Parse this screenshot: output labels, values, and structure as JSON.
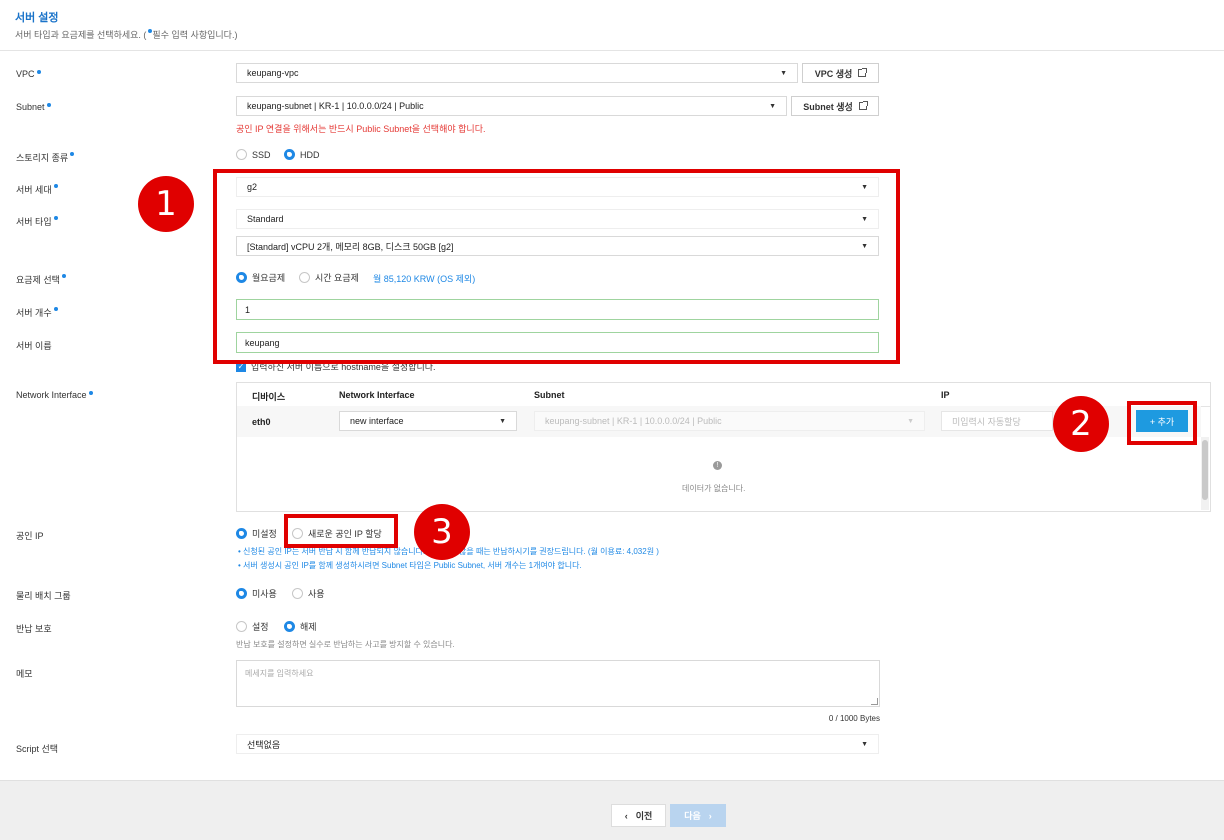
{
  "header": {
    "title": "서버 설정",
    "subtitle_prefix": "서버 타입과 요금제를 선택하세요. (",
    "subtitle_suffix": "필수 입력 사항입니다.)"
  },
  "vpc": {
    "label": "VPC",
    "value": "keupang-vpc",
    "create_label": "VPC 생성"
  },
  "subnet": {
    "label": "Subnet",
    "value": "keupang-subnet | KR-1 | 10.0.0.0/24 | Public",
    "create_label": "Subnet 생성",
    "warning": "공인 IP 연결을 위해서는 반드시 Public Subnet을 선택해야 합니다."
  },
  "storage": {
    "label": "스토리지 종류",
    "options": [
      "SSD",
      "HDD"
    ],
    "selected": "HDD"
  },
  "generation": {
    "label": "서버 세대",
    "value": "g2"
  },
  "server_type": {
    "label": "서버 타입",
    "value": "Standard",
    "spec": "[Standard] vCPU 2개, 메모리 8GB, 디스크 50GB [g2]"
  },
  "pricing": {
    "label": "요금제 선택",
    "options": [
      "월요금제",
      "시간 요금제"
    ],
    "selected": "월요금제",
    "price": "월 85,120 KRW (OS 제외)"
  },
  "server_count": {
    "label": "서버 개수",
    "value": "1"
  },
  "server_name": {
    "label": "서버 이름",
    "value": "keupang",
    "hostname_note": "입력하신 서버 이름으로 hostname을 설정합니다."
  },
  "network_interface": {
    "label": "Network Interface",
    "columns": [
      "디바이스",
      "Network Interface",
      "Subnet",
      "IP"
    ],
    "row": {
      "device": "eth0",
      "interface": "new interface",
      "subnet": "keupang-subnet | KR-1 | 10.0.0.0/24 | Public",
      "ip_placeholder": "미입력시 자동할당"
    },
    "add_label": "+ 추가",
    "empty_text": "데이터가 없습니다."
  },
  "public_ip": {
    "label": "공인 IP",
    "options": [
      "미설정",
      "새로운 공인 IP 할당"
    ],
    "selected": "미설정",
    "note1": "신청된 공인 IP는 서버 반납 시 함께 반납되지 않습니다. 사용하지 않을 때는 반납하시기를 권장드립니다. (월 이용료: 4,032원 )",
    "note2": "서버 생성시 공인 IP를 함께 생성하시려면 Subnet 타입은 Public Subnet, 서버 개수는 1개여야 합니다."
  },
  "placement_group": {
    "label": "물리 배치 그룹",
    "options": [
      "미사용",
      "사용"
    ],
    "selected": "미사용"
  },
  "return_protection": {
    "label": "반납 보호",
    "options": [
      "설정",
      "해제"
    ],
    "selected": "해제",
    "note": "반납 보호를 설정하면 실수로 반납하는 사고를 방지할 수 있습니다."
  },
  "memo": {
    "label": "메모",
    "placeholder": "메세지를 입력하세요",
    "counter": "0 / 1000 Bytes"
  },
  "script": {
    "label": "Script 선택",
    "value": "선택없음"
  },
  "footer": {
    "prev_label": "이전",
    "next_label": "다음"
  },
  "annotations": {
    "one": "1",
    "two": "2",
    "three": "3"
  },
  "colors": {
    "accent": "#1e88e5",
    "annotation_red": "#e00000",
    "warning": "#e53935"
  }
}
